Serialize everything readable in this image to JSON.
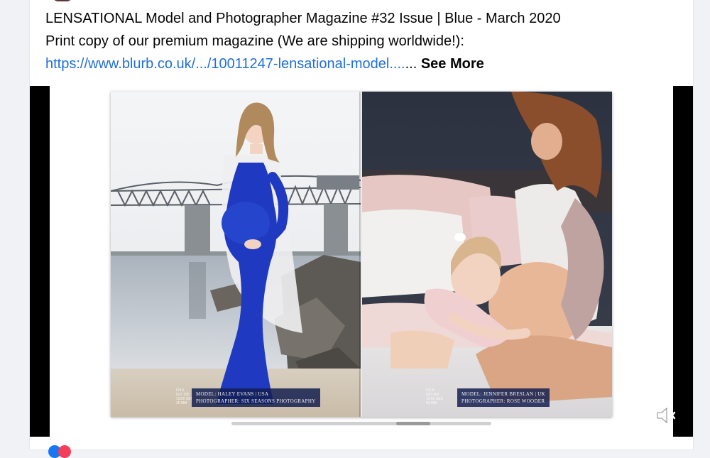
{
  "post": {
    "title_line": "LENSATIONAL Model and Photographer Magazine #32 Issue | Blue - March 2020",
    "description": "Print copy of our premium magazine (We are shipping worldwide!):",
    "link_text": "https://www.blurb.co.uk/.../10011247-lensational-model....",
    "ellipsis": "...",
    "see_more": "See More"
  },
  "magazine": {
    "left_page": {
      "model_credit": "Model: Haley Evans | USA",
      "photographer_credit": "Photographer: Six Seasons Photography",
      "exif": [
        "F/5.6",
        "ISO 100",
        "1/320 SEC",
        "35 MM"
      ]
    },
    "right_page": {
      "model_credit": "Model: Jennifer Breslan | UK",
      "photographer_credit": "Photographer: Rose Wooder",
      "exif": [
        "F/2.8",
        "ISO 400",
        "1/160 SEC",
        "50 MM"
      ]
    }
  },
  "video_controls": {
    "mute_icon": "speaker-muted-icon",
    "progress_fraction": 0.73
  },
  "colors": {
    "link": "#216fdb",
    "dress_blue": "#1f3ac0",
    "credit_bg": "#1e2a6b"
  }
}
